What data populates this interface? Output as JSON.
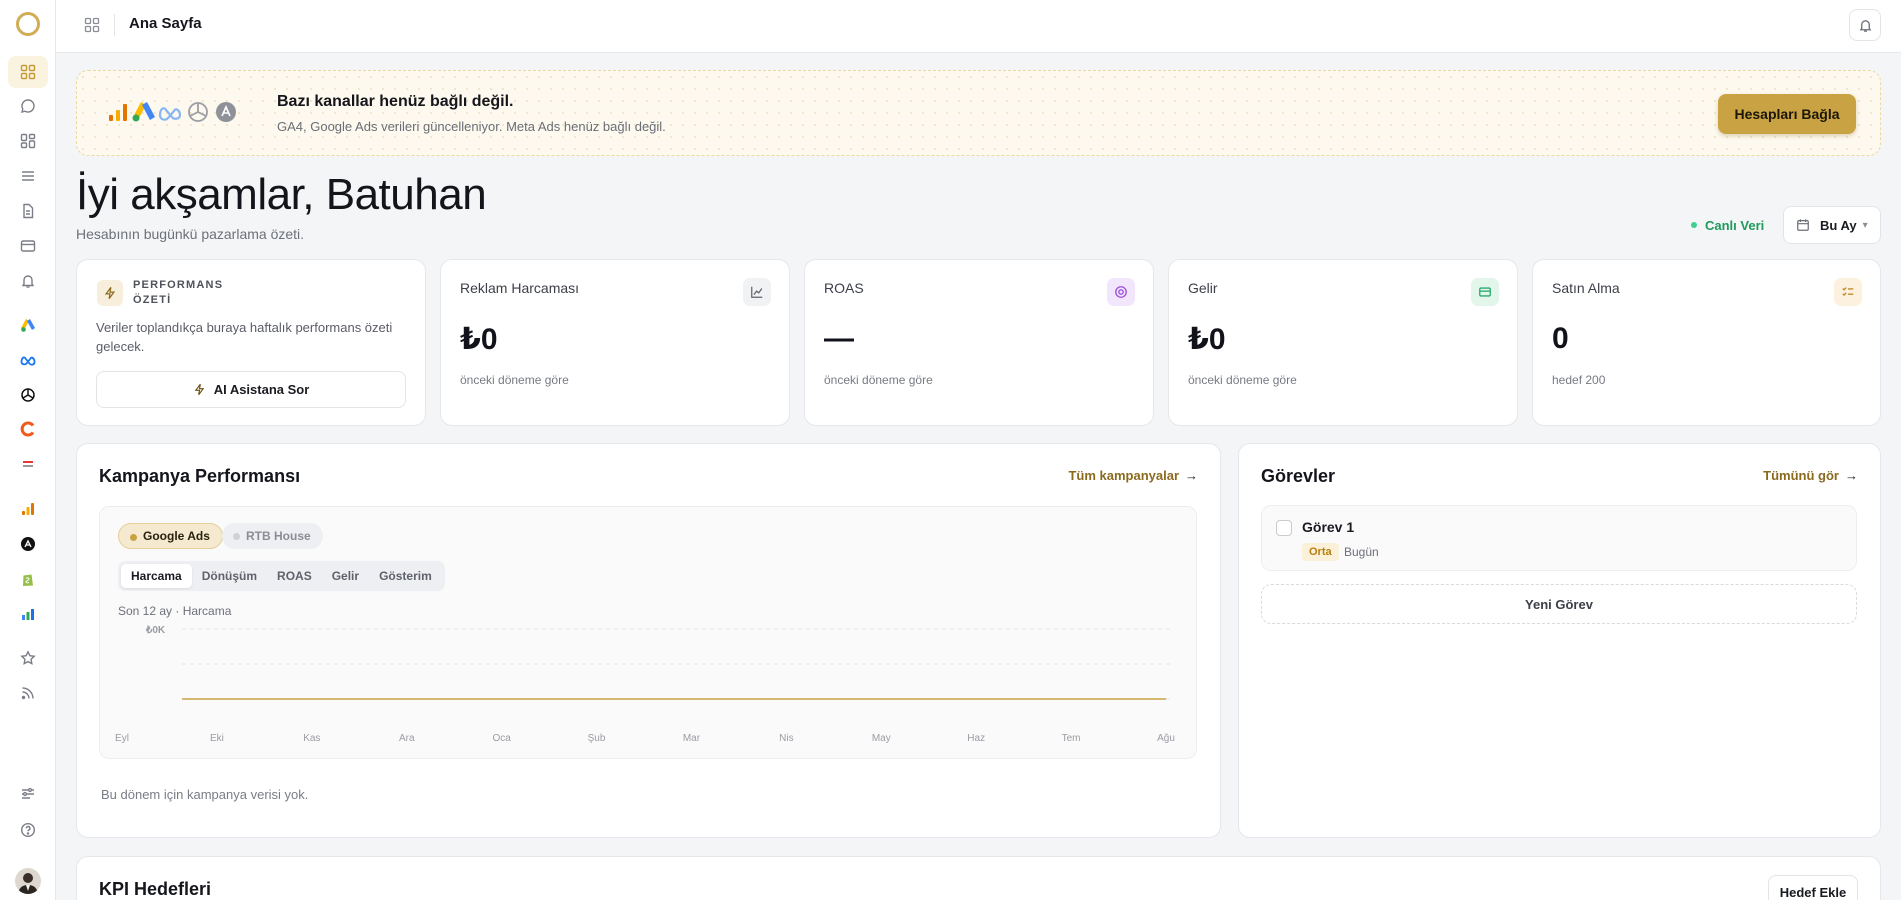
{
  "topbar": {
    "title": "Ana Sayfa"
  },
  "banner": {
    "title": "Bazı kanallar henüz bağlı değil.",
    "subtitle": "GA4, Google Ads verileri güncelleniyor. Meta Ads henüz bağlı değil.",
    "button": "Hesapları Bağla"
  },
  "greeting": {
    "title": "İyi akşamlar, Batuhan",
    "subtitle": "Hesabının bugünkü pazarlama özeti."
  },
  "controls": {
    "live": "Canlı Veri",
    "period": "Bu Ay"
  },
  "performance": {
    "title": "PERFORMANS ÖZETİ",
    "text": "Veriler toplandıkça buraya haftalık performans özeti gelecek.",
    "button": "AI Asistana Sor"
  },
  "metrics": [
    {
      "label": "Reklam Harcaması",
      "value": "₺0",
      "note": "önceki döneme göre",
      "icon": "line-chart-icon",
      "icon_bg": "#f1f2f4",
      "icon_color": "#5f626b"
    },
    {
      "label": "ROAS",
      "value": "—",
      "note": "önceki döneme göre",
      "icon": "target-icon",
      "icon_bg": "#f1e6fb",
      "icon_color": "#9b4fd8"
    },
    {
      "label": "Gelir",
      "value": "₺0",
      "note": "önceki döneme göre",
      "icon": "card-icon",
      "icon_bg": "#e3f6ec",
      "icon_color": "#2aa86b"
    },
    {
      "label": "Satın Alma",
      "value": "0",
      "note": "hedef 200",
      "icon": "list-check-icon",
      "icon_bg": "#fcf1de",
      "icon_color": "#c08a2a"
    }
  ],
  "campaign": {
    "title": "Kampanya Performansı",
    "link": "Tüm kampanyalar",
    "chips": [
      "Google Ads",
      "RTB House"
    ],
    "tabs": [
      "Harcama",
      "Dönüşüm",
      "ROAS",
      "Gelir",
      "Gösterim"
    ],
    "caption": "Son 12 ay · Harcama",
    "empty": "Bu dönem için kampanya verisi yok."
  },
  "chart_data": {
    "type": "line",
    "categories": [
      "Eyl",
      "Eki",
      "Kas",
      "Ara",
      "Oca",
      "Şub",
      "Mar",
      "Nis",
      "May",
      "Haz",
      "Tem",
      "Ağu"
    ],
    "series": [
      {
        "name": "Google Ads",
        "values": [
          0,
          0,
          0,
          0,
          0,
          0,
          0,
          0,
          0,
          0,
          0,
          0
        ]
      }
    ],
    "ytick_top": "₺0K",
    "color": "#c9a343"
  },
  "tasks": {
    "title": "Görevler",
    "link": "Tümünü gör",
    "items": [
      {
        "title": "Görev 1",
        "priority": "Orta",
        "date": "Bugün"
      }
    ],
    "new_button": "Yeni Görev"
  },
  "kpi": {
    "title": "KPI Hedefleri",
    "button": "Hedef Ekle"
  }
}
